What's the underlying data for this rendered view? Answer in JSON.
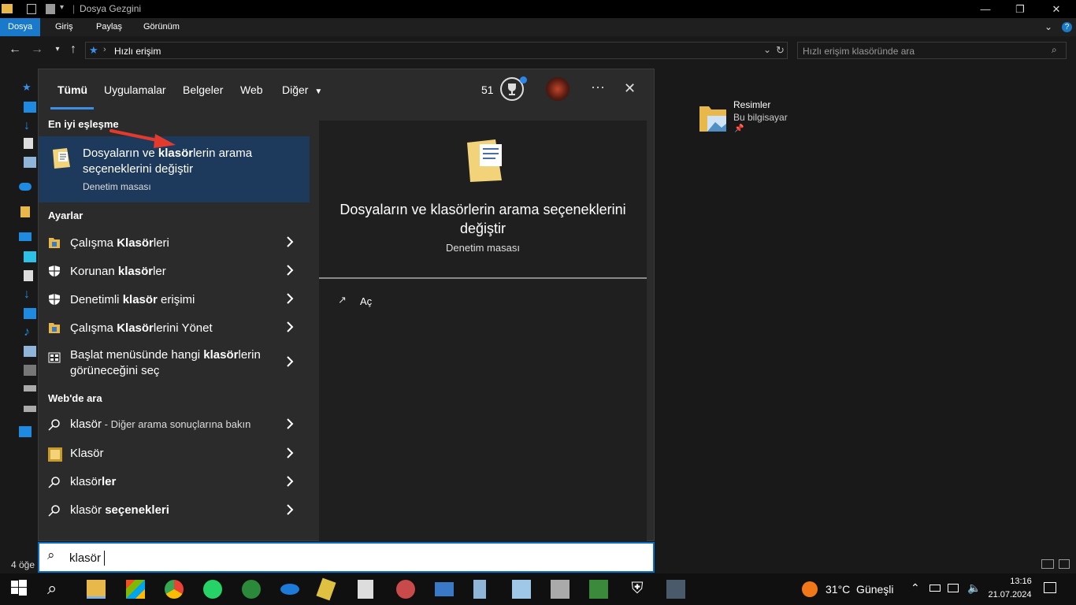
{
  "window": {
    "title": "Dosya Gezgini",
    "ribbon_tabs": [
      "Dosya",
      "Giriş",
      "Paylaş",
      "Görünüm"
    ],
    "address": {
      "path": "Hızlı erişim"
    },
    "search_placeholder": "Hızlı erişim klasöründe ara",
    "item": {
      "name": "Resimler",
      "location": "Bu bilgisayar"
    },
    "status": "4 öğe"
  },
  "search_panel": {
    "tabs": [
      "Tümü",
      "Uygulamalar",
      "Belgeler",
      "Web",
      "Diğer"
    ],
    "points": "51",
    "best_match": {
      "header": "En iyi eşleşme",
      "line1_pre": "Dosyaların ve ",
      "line1_bold": "klasör",
      "line1_post": "lerin arama",
      "line2": "seçeneklerini değiştir",
      "subtitle": "Denetim masası"
    },
    "settings": {
      "header": "Ayarlar",
      "items": [
        {
          "pre": "Çalışma ",
          "bold": "Klasör",
          "post": "leri",
          "icon": "work-folders-icon"
        },
        {
          "pre": "Korunan ",
          "bold": "klasör",
          "post": "ler",
          "icon": "shield-icon"
        },
        {
          "pre": "Denetimli ",
          "bold": "klasör",
          "post": " erişimi",
          "icon": "shield-icon"
        },
        {
          "pre": "Çalışma ",
          "bold": "Klasör",
          "post": "lerini Yönet",
          "icon": "work-folders-icon"
        },
        {
          "pre": "Başlat menüsünde hangi ",
          "bold": "klasör",
          "post": "lerin",
          "line2": "görüneceğini seç",
          "icon": "start-menu-icon"
        }
      ]
    },
    "web": {
      "header": "Web'de ara",
      "items": [
        {
          "main": "klasör",
          "suffix": " - Diğer arama sonuçlarına bakın",
          "icon": "search-icon"
        },
        {
          "main": "Klasör",
          "suffix": "",
          "icon": "image-thumb-icon"
        },
        {
          "main": "klasör",
          "bold": "ler",
          "icon": "search-icon"
        },
        {
          "main": "klasör ",
          "bold": "seçenekleri",
          "icon": "search-icon"
        }
      ]
    },
    "preview": {
      "title_line1": "Dosyaların ve klasörlerin arama seçeneklerini",
      "title_line2": "değiştir",
      "subtitle": "Denetim masası",
      "action": "Aç"
    },
    "query": "klasör"
  },
  "taskbar": {
    "weather": "31°C  Güneşli",
    "time": "13:16",
    "date": "21.07.2024"
  },
  "colors": {
    "accent": "#1979ca",
    "selection": "#1d3a5c",
    "arrow": "#e23b2e"
  }
}
